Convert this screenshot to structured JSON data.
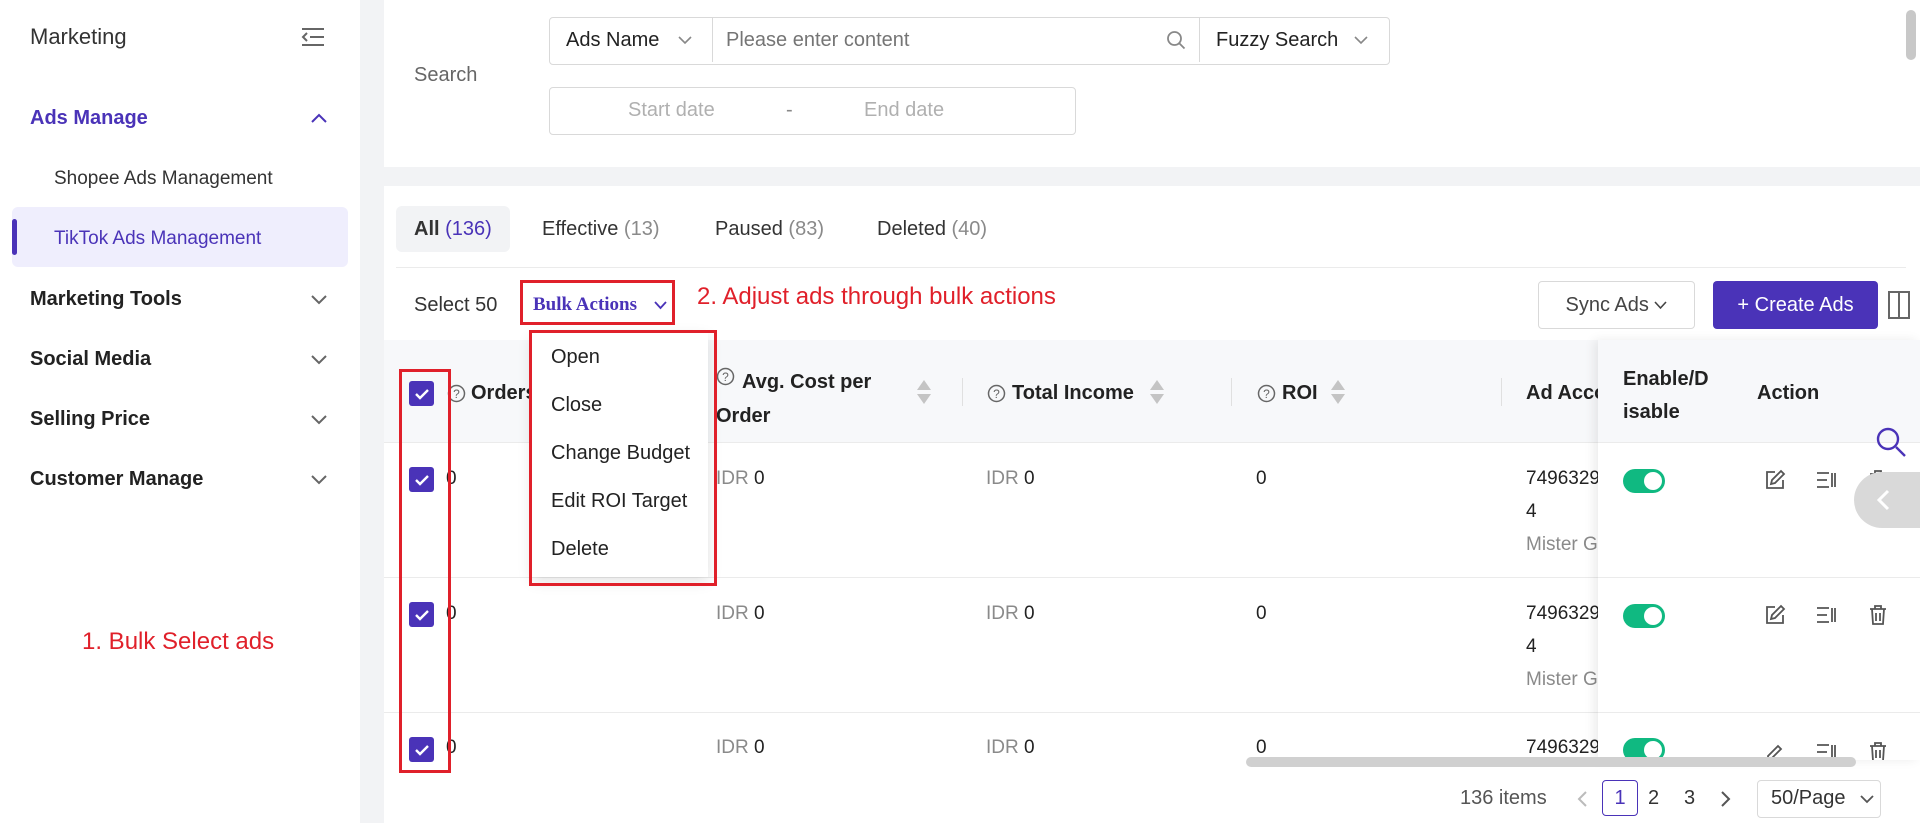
{
  "sidebar": {
    "title": "Marketing",
    "groups": [
      {
        "label": "Ads Manage",
        "items": [
          {
            "label": "Shopee Ads Management"
          },
          {
            "label": "TikTok Ads Management"
          }
        ]
      },
      {
        "label": "Marketing Tools"
      },
      {
        "label": "Social Media"
      },
      {
        "label": "Selling Price"
      },
      {
        "label": "Customer Manage"
      }
    ],
    "accent": "#4a33b8"
  },
  "annotations": {
    "step1": "1. Bulk Select ads",
    "step2": "2. Adjust ads through bulk actions",
    "color": "#e0202a"
  },
  "search": {
    "label": "Search",
    "field_select": "Ads Name",
    "placeholder": "Please enter content",
    "mode": "Fuzzy Search",
    "start_placeholder": "Start date",
    "date_sep": "-",
    "end_placeholder": "End date"
  },
  "tabs": [
    {
      "label": "All",
      "count": "(136)"
    },
    {
      "label": "Effective",
      "count": "(13)"
    },
    {
      "label": "Paused",
      "count": "(83)"
    },
    {
      "label": "Deleted",
      "count": "(40)"
    }
  ],
  "toolbar": {
    "select_text": "Select 50",
    "bulk_actions": "Bulk Actions",
    "sync_ads": "Sync Ads",
    "create_ads": "+ Create Ads"
  },
  "bulk_menu": [
    "Open",
    "Close",
    "Change Budget",
    "Edit ROI Target",
    "Delete"
  ],
  "table": {
    "headers": {
      "orders": "Orders",
      "avg_cost": "Avg. Cost per Order",
      "total_income": "Total Income",
      "roi": "ROI",
      "ad_account": "Ad Acco",
      "enable": "Enable/Disable",
      "action": "Action"
    },
    "rows": [
      {
        "orders": "0",
        "avg_currency": "IDR",
        "avg": "0",
        "inc_currency": "IDR",
        "income": "0",
        "roi": "0",
        "account": "7496329",
        "account2": "4",
        "account_name": "Mister G"
      },
      {
        "orders": "0",
        "avg_currency": "IDR",
        "avg": "0",
        "inc_currency": "IDR",
        "income": "0",
        "roi": "0",
        "account": "7496329",
        "account2": "4",
        "account_name": "Mister G"
      },
      {
        "orders": "0",
        "avg_currency": "IDR",
        "avg": "0",
        "inc_currency": "IDR",
        "income": "0",
        "roi": "0",
        "account": "7496329"
      }
    ]
  },
  "pagination": {
    "total": "136 items",
    "pages": [
      "1",
      "2",
      "3"
    ],
    "page_size": "50/Page"
  }
}
